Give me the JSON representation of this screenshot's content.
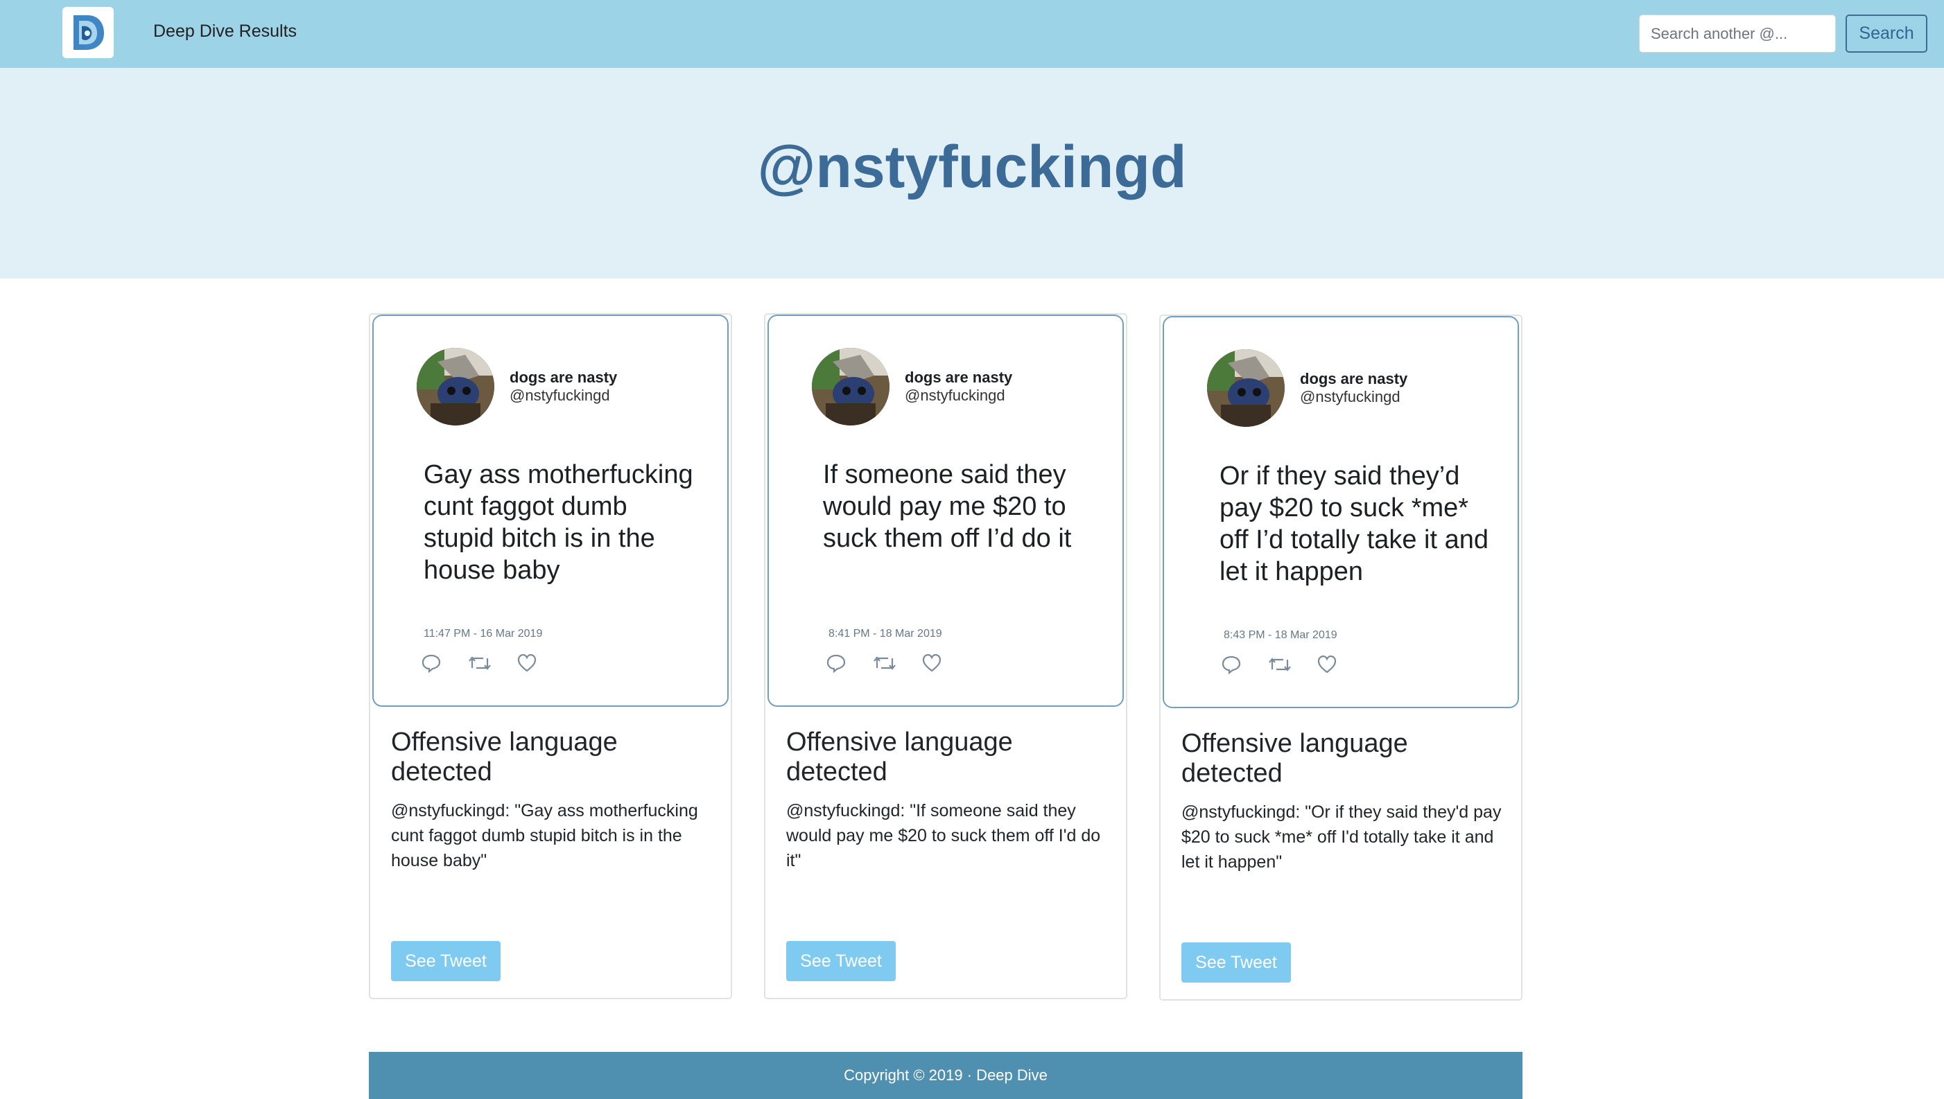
{
  "navbar": {
    "brand": "Deep Dive Results",
    "search_placeholder": "Search another @...",
    "search_button": "Search",
    "logo_icon": "deep-dive-logo-icon"
  },
  "hero": {
    "title": "@nstyfuckingd"
  },
  "colors": {
    "navbar_bg": "#9dd3e6",
    "hero_bg": "#e1f0f7",
    "title": "#3b6b96",
    "tweet_border": "#6f9fc4",
    "see_tweet_button": "#7fcaf0",
    "footer_bg": "#4f8fb0"
  },
  "cards": [
    {
      "tweet": {
        "name": "dogs are nasty",
        "handle": "@nstyfuckingd",
        "text": "Gay ass motherfucking cunt faggot dumb stupid bitch is in the house baby",
        "date": "11:47 PM - 16 Mar 2019",
        "icons": [
          "reply-icon",
          "retweet-icon",
          "like-icon"
        ]
      },
      "title": "Offensive language detected",
      "body": "@nstyfuckingd: \"Gay ass motherfucking cunt faggot dumb stupid bitch is in the house baby\"",
      "button": "See Tweet"
    },
    {
      "tweet": {
        "name": "dogs are nasty",
        "handle": "@nstyfuckingd",
        "text": "If someone said they would pay me $20 to suck them off I’d do it",
        "date": "8:41 PM - 18 Mar 2019",
        "icons": [
          "reply-icon",
          "retweet-icon",
          "like-icon"
        ]
      },
      "title": "Offensive language detected",
      "body": "@nstyfuckingd: \"If someone said they would pay me $20 to suck them off I'd do it\"",
      "button": "See Tweet"
    },
    {
      "tweet": {
        "name": "dogs are nasty",
        "handle": "@nstyfuckingd",
        "text": "Or if they said they’d pay $20 to suck *me* off I’d totally take it and let it happen",
        "date": "8:43 PM - 18 Mar 2019",
        "icons": [
          "reply-icon",
          "retweet-icon",
          "like-icon"
        ]
      },
      "title": "Offensive language detected",
      "body": "@nstyfuckingd: \"Or if they said they'd pay $20 to suck *me* off I'd totally take it and let it happen\"",
      "button": "See Tweet"
    }
  ],
  "footer": {
    "text": "Copyright © 2019 · Deep Dive"
  }
}
